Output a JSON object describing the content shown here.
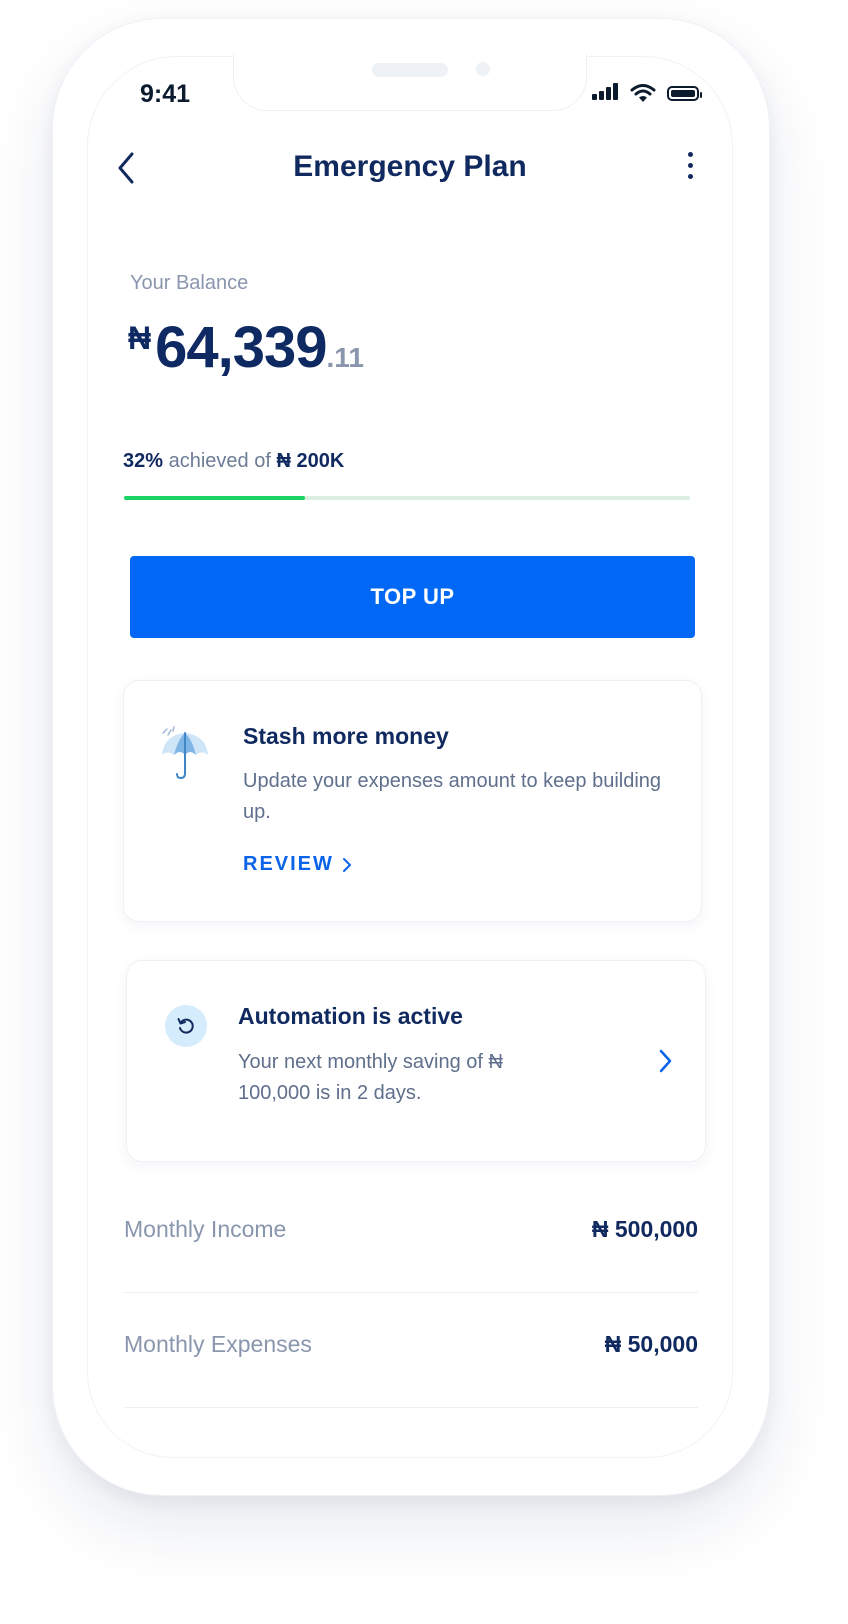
{
  "status_bar": {
    "time": "9:41"
  },
  "header": {
    "title": "Emergency Plan"
  },
  "balance": {
    "label": "Your Balance",
    "currency": "₦",
    "whole": "64,339",
    "decimal": ".11"
  },
  "progress": {
    "percent_text": "32%",
    "middle_text": "achieved of",
    "target_text": "₦ 200K",
    "fraction": 0.32,
    "fill_color": "#1bd365",
    "track_color": "#dceedf"
  },
  "top_up": {
    "label": "TOP UP",
    "color": "#0068f5"
  },
  "stash_card": {
    "title": "Stash more money",
    "body": "Update your expenses amount to keep building up.",
    "link_label": "REVIEW",
    "icon": "umbrella-icon"
  },
  "automation_card": {
    "title": "Automation is active",
    "body": "Your next monthly saving of ₦ 100,000 is in 2 days.",
    "icon": "refresh-icon"
  },
  "summary": [
    {
      "label": "Monthly Income",
      "value": "₦ 500,000"
    },
    {
      "label": "Monthly Expenses",
      "value": "₦ 50,000"
    }
  ]
}
